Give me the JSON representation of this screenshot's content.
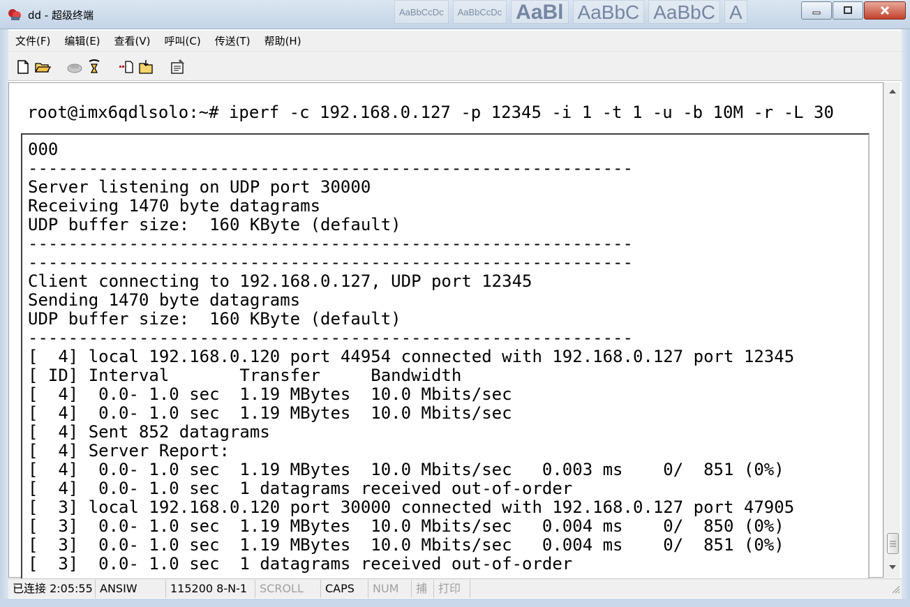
{
  "window": {
    "title": "dd - 超级终端",
    "colors": {
      "titlebar": "#c3d4e7",
      "close": "#c3412c"
    }
  },
  "ribbon_ghost": [
    "AaBbCcDc",
    "AaBbCcDc",
    "AaBl",
    "AaBbC",
    "AaBbC",
    "A"
  ],
  "menu": {
    "items": [
      "文件(F)",
      "编辑(E)",
      "查看(V)",
      "呼叫(C)",
      "传送(T)",
      "帮助(H)"
    ]
  },
  "toolbar": {
    "icons": [
      "new-icon",
      "open-icon",
      "disconnect-icon",
      "dial-icon",
      "send-icon",
      "receive-icon",
      "properties-icon"
    ]
  },
  "terminal": {
    "command": "root@imx6qdlsolo:~# iperf -c 192.168.0.127 -p 12345 -i 1 -t 1 -u -b 10M -r -L 30",
    "lines": [
      "000",
      "------------------------------------------------------------",
      "Server listening on UDP port 30000",
      "Receiving 1470 byte datagrams",
      "UDP buffer size:  160 KByte (default)",
      "------------------------------------------------------------",
      "------------------------------------------------------------",
      "Client connecting to 192.168.0.127, UDP port 12345",
      "Sending 1470 byte datagrams",
      "UDP buffer size:  160 KByte (default)",
      "------------------------------------------------------------",
      "[  4] local 192.168.0.120 port 44954 connected with 192.168.0.127 port 12345",
      "[ ID] Interval       Transfer     Bandwidth",
      "[  4]  0.0- 1.0 sec  1.19 MBytes  10.0 Mbits/sec",
      "[  4]  0.0- 1.0 sec  1.19 MBytes  10.0 Mbits/sec",
      "[  4] Sent 852 datagrams",
      "[  4] Server Report:",
      "[  4]  0.0- 1.0 sec  1.19 MBytes  10.0 Mbits/sec   0.003 ms    0/  851 (0%)",
      "[  4]  0.0- 1.0 sec  1 datagrams received out-of-order",
      "[  3] local 192.168.0.120 port 30000 connected with 192.168.0.127 port 47905",
      "[  3]  0.0- 1.0 sec  1.19 MBytes  10.0 Mbits/sec   0.004 ms    0/  850 (0%)",
      "[  3]  0.0- 1.0 sec  1.19 MBytes  10.0 Mbits/sec   0.004 ms    0/  851 (0%)",
      "[  3]  0.0- 1.0 sec  1 datagrams received out-of-order"
    ]
  },
  "statusbar": {
    "connected": "已连接 2:05:55",
    "emulation": "ANSIW",
    "port_settings": "115200 8-N-1",
    "scroll": "SCROLL",
    "caps": "CAPS",
    "num": "NUM",
    "capture": "捕",
    "print": "打印"
  }
}
